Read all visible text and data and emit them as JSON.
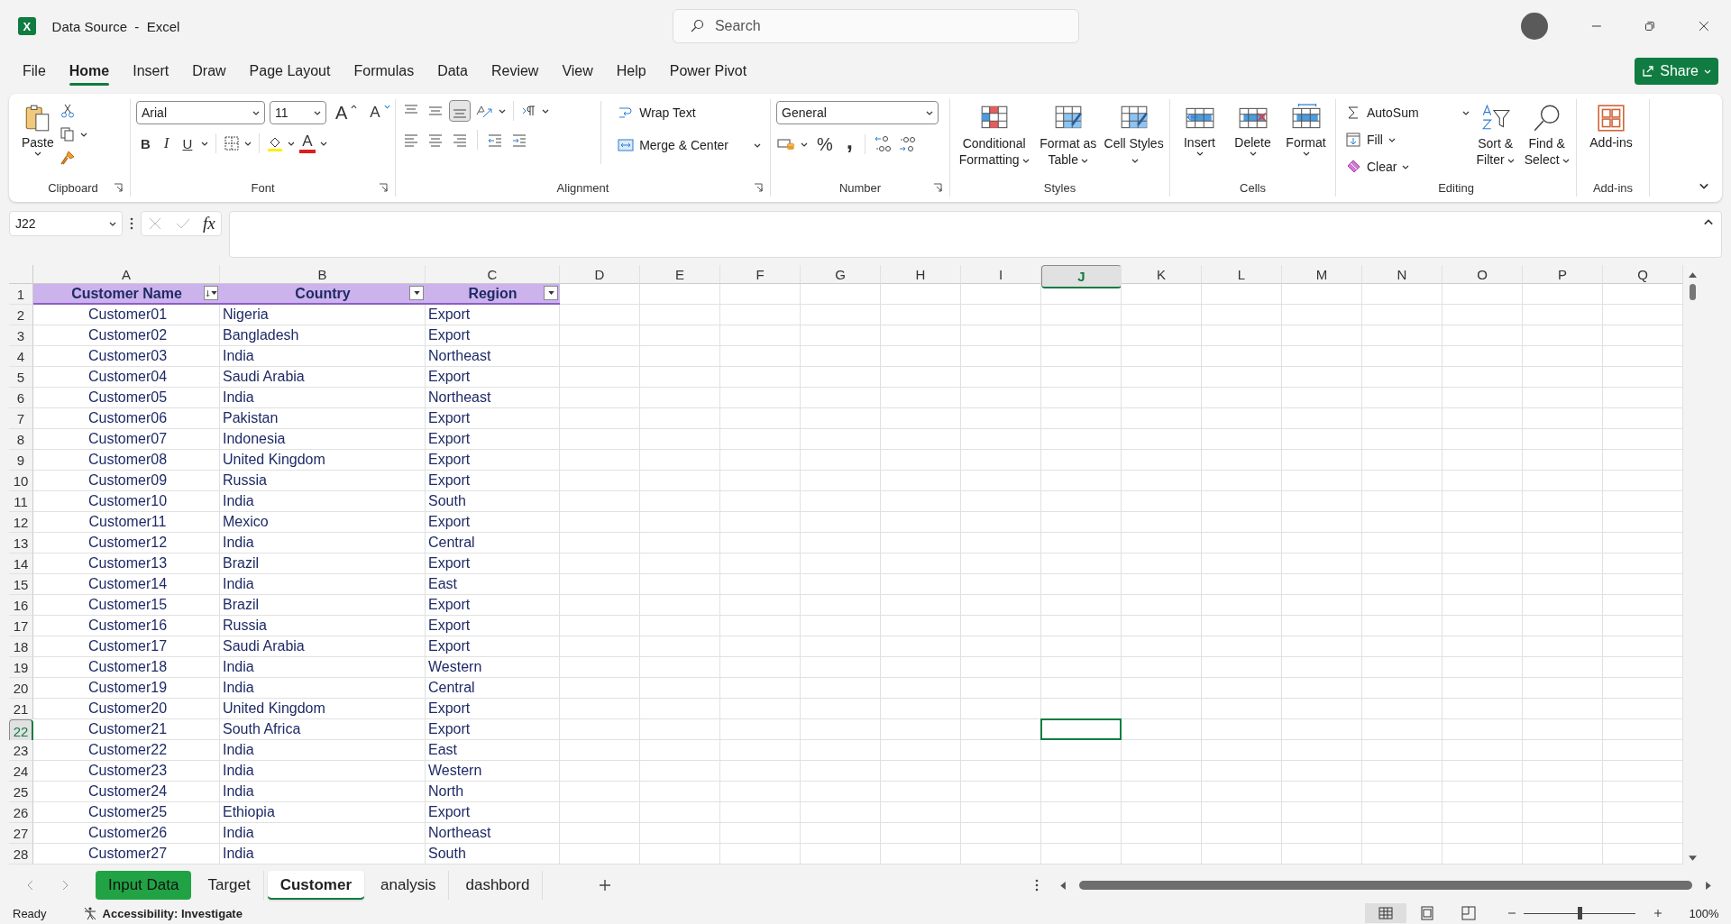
{
  "window": {
    "logo_letter": "X",
    "title": "Data Source  -  Excel",
    "search_placeholder": "Search"
  },
  "ribbon_tabs": [
    {
      "label": "File",
      "selected": false
    },
    {
      "label": "Home",
      "selected": true
    },
    {
      "label": "Insert",
      "selected": false
    },
    {
      "label": "Draw",
      "selected": false
    },
    {
      "label": "Page Layout",
      "selected": false
    },
    {
      "label": "Formulas",
      "selected": false
    },
    {
      "label": "Data",
      "selected": false
    },
    {
      "label": "Review",
      "selected": false
    },
    {
      "label": "View",
      "selected": false
    },
    {
      "label": "Help",
      "selected": false
    },
    {
      "label": "Power Pivot",
      "selected": false
    }
  ],
  "share_button": "Share",
  "ribbon": {
    "clipboard": {
      "label": "Clipboard",
      "paste": "Paste"
    },
    "font": {
      "label": "Font",
      "font_name": "Arial",
      "font_size": "11",
      "grow": "A",
      "shrink": "A",
      "bold": "B",
      "italic": "I",
      "underline": "U",
      "font_color": "A"
    },
    "alignment": {
      "label": "Alignment",
      "bottom_align": {
        "on": true
      },
      "wrap_text": "Wrap Text",
      "merge_center": "Merge & Center"
    },
    "number": {
      "label": "Number",
      "format": "General",
      "percent": "%",
      "comma": ","
    },
    "styles": {
      "label": "Styles",
      "buttons": [
        "Conditional Formatting",
        "Format as Table",
        "Cell Styles"
      ]
    },
    "cells": {
      "label": "Cells",
      "buttons": [
        "Insert",
        "Delete",
        "Format"
      ]
    },
    "editing": {
      "label": "Editing",
      "autosum": "AutoSum",
      "fill": "Fill",
      "clear": "Clear",
      "sort": "Sort & Filter",
      "find": "Find & Select"
    },
    "addins": {
      "label": "Add-ins",
      "button": "Add-ins"
    }
  },
  "formula_bar": {
    "name_box": "J22",
    "fx_label": "fx"
  },
  "sheet": {
    "columns": [
      {
        "label": "A",
        "selected": false
      },
      {
        "label": "B",
        "selected": false
      },
      {
        "label": "C",
        "selected": false
      },
      {
        "label": "D",
        "selected": false
      },
      {
        "label": "E",
        "selected": false
      },
      {
        "label": "F",
        "selected": false
      },
      {
        "label": "G",
        "selected": false
      },
      {
        "label": "H",
        "selected": false
      },
      {
        "label": "I",
        "selected": false
      },
      {
        "label": "J",
        "selected": true
      },
      {
        "label": "K",
        "selected": false
      },
      {
        "label": "L",
        "selected": false
      },
      {
        "label": "M",
        "selected": false
      },
      {
        "label": "N",
        "selected": false
      },
      {
        "label": "O",
        "selected": false
      },
      {
        "label": "P",
        "selected": false
      },
      {
        "label": "Q",
        "selected": false
      }
    ],
    "header_row": {
      "number": "1",
      "selected": false,
      "cells": [
        {
          "text": "Customer Name",
          "sorted": true
        },
        {
          "text": "Country",
          "sorted": false
        },
        {
          "text": "Region",
          "sorted": false
        }
      ]
    },
    "rows": [
      {
        "number": "2",
        "selected": false,
        "cells": [
          "Customer01",
          "Nigeria",
          "Export"
        ]
      },
      {
        "number": "3",
        "selected": false,
        "cells": [
          "Customer02",
          "Bangladesh",
          "Export"
        ]
      },
      {
        "number": "4",
        "selected": false,
        "cells": [
          "Customer03",
          "India",
          "Northeast"
        ]
      },
      {
        "number": "5",
        "selected": false,
        "cells": [
          "Customer04",
          "Saudi Arabia",
          "Export"
        ]
      },
      {
        "number": "6",
        "selected": false,
        "cells": [
          "Customer05",
          "India",
          "Northeast"
        ]
      },
      {
        "number": "7",
        "selected": false,
        "cells": [
          "Customer06",
          "Pakistan",
          "Export"
        ]
      },
      {
        "number": "8",
        "selected": false,
        "cells": [
          "Customer07",
          "Indonesia",
          "Export"
        ]
      },
      {
        "number": "9",
        "selected": false,
        "cells": [
          "Customer08",
          "United Kingdom",
          "Export"
        ]
      },
      {
        "number": "10",
        "selected": false,
        "cells": [
          "Customer09",
          "Russia",
          "Export"
        ]
      },
      {
        "number": "11",
        "selected": false,
        "cells": [
          "Customer10",
          "India",
          "South"
        ]
      },
      {
        "number": "12",
        "selected": false,
        "cells": [
          "Customer11",
          "Mexico",
          "Export"
        ]
      },
      {
        "number": "13",
        "selected": false,
        "cells": [
          "Customer12",
          "India",
          "Central"
        ]
      },
      {
        "number": "14",
        "selected": false,
        "cells": [
          "Customer13",
          "Brazil",
          "Export"
        ]
      },
      {
        "number": "15",
        "selected": false,
        "cells": [
          "Customer14",
          "India",
          "East"
        ]
      },
      {
        "number": "16",
        "selected": false,
        "cells": [
          "Customer15",
          "Brazil",
          "Export"
        ]
      },
      {
        "number": "17",
        "selected": false,
        "cells": [
          "Customer16",
          "Russia",
          "Export"
        ]
      },
      {
        "number": "18",
        "selected": false,
        "cells": [
          "Customer17",
          "Saudi Arabia",
          "Export"
        ]
      },
      {
        "number": "19",
        "selected": false,
        "cells": [
          "Customer18",
          "India",
          "Western"
        ]
      },
      {
        "number": "20",
        "selected": false,
        "cells": [
          "Customer19",
          "India",
          "Central"
        ]
      },
      {
        "number": "21",
        "selected": false,
        "cells": [
          "Customer20",
          "United Kingdom",
          "Export"
        ]
      },
      {
        "number": "22",
        "selected": true,
        "cells": [
          "Customer21",
          "South Africa",
          "Export"
        ]
      },
      {
        "number": "23",
        "selected": false,
        "cells": [
          "Customer22",
          "India",
          "East"
        ]
      },
      {
        "number": "24",
        "selected": false,
        "cells": [
          "Customer23",
          "India",
          "Western"
        ]
      },
      {
        "number": "25",
        "selected": false,
        "cells": [
          "Customer24",
          "India",
          "North"
        ]
      },
      {
        "number": "26",
        "selected": false,
        "cells": [
          "Customer25",
          "Ethiopia",
          "Export"
        ]
      },
      {
        "number": "27",
        "selected": false,
        "cells": [
          "Customer26",
          "India",
          "Northeast"
        ]
      },
      {
        "number": "28",
        "selected": false,
        "cells": [
          "Customer27",
          "India",
          "South"
        ]
      }
    ]
  },
  "sheet_tabs": [
    {
      "label": "Input Data",
      "selected": false,
      "color": "#21a345"
    },
    {
      "label": "Target",
      "selected": false
    },
    {
      "label": "Customer",
      "selected": true
    },
    {
      "label": "analysis",
      "selected": false
    },
    {
      "label": "dashbord",
      "selected": false
    }
  ],
  "status_bar": {
    "status": "Ready",
    "accessibility": "Accessibility: Investigate",
    "views": [
      {
        "selected": true
      },
      {
        "selected": false
      },
      {
        "selected": false
      }
    ],
    "zoom": {
      "level": 0.5
    },
    "zoom_label": "100%"
  }
}
